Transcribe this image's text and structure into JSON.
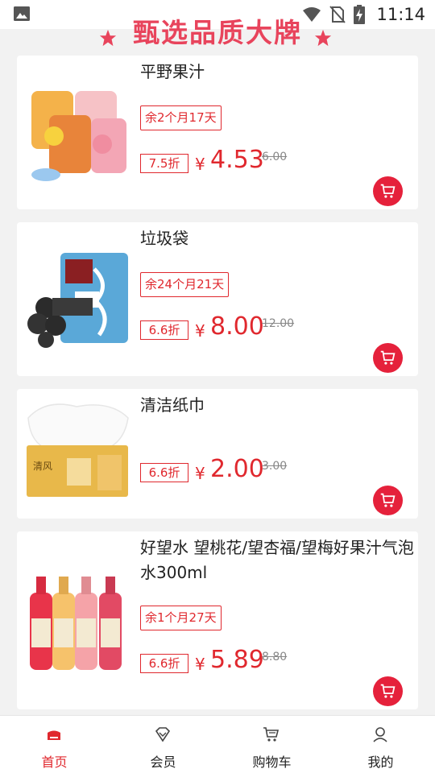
{
  "status_bar": {
    "time": "11:14"
  },
  "header": {
    "title": "甄选品质大牌"
  },
  "products": [
    {
      "name": "平野果汁",
      "remaining": "余2个月17天",
      "discount": "7.5折",
      "currency": "¥",
      "price": "4.53",
      "original_price": "6.00"
    },
    {
      "name": "垃圾袋",
      "remaining": "余24个月21天",
      "discount": "6.6折",
      "currency": "¥",
      "price": "8.00",
      "original_price": "12.00"
    },
    {
      "name": "清洁纸巾",
      "remaining": "",
      "discount": "6.6折",
      "currency": "¥",
      "price": "2.00",
      "original_price": "3.00"
    },
    {
      "name": "好望水 望桃花/望杏福/望梅好果汁气泡水300ml",
      "remaining": "余1个月27天",
      "discount": "6.6折",
      "currency": "¥",
      "price": "5.89",
      "original_price": "8.80"
    }
  ],
  "tabbar": {
    "items": [
      {
        "label": "首页",
        "icon": "home-icon",
        "active": true
      },
      {
        "label": "会员",
        "icon": "diamond-icon",
        "active": false
      },
      {
        "label": "购物车",
        "icon": "cart-icon",
        "active": false
      },
      {
        "label": "我的",
        "icon": "user-icon",
        "active": false
      }
    ]
  },
  "colors": {
    "accent": "#e0282e",
    "title": "#e8445c",
    "cart_button": "#e5213b"
  }
}
